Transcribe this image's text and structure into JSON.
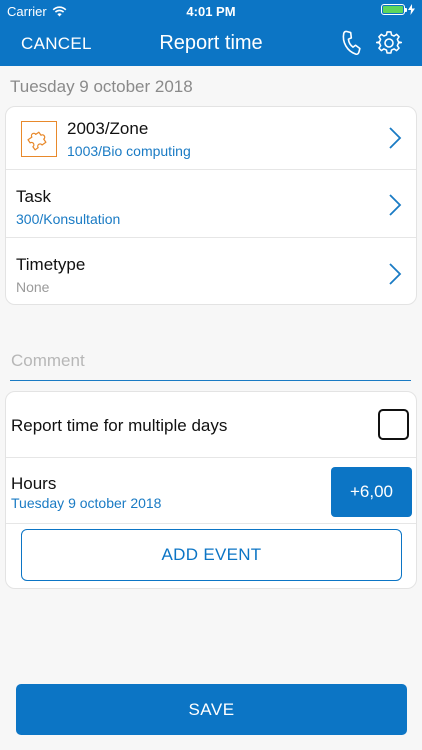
{
  "status_bar": {
    "carrier": "Carrier",
    "time": "4:01 PM"
  },
  "nav": {
    "cancel_label": "CANCEL",
    "title": "Report time",
    "phone_icon": "phone-icon",
    "settings_icon": "gear-icon"
  },
  "date_heading": "Tuesday 9 october 2018",
  "project_row": {
    "icon": "puzzle-icon",
    "title": "2003/Zone",
    "subtitle": "1003/Bio computing"
  },
  "task_row": {
    "title": "Task",
    "subtitle": "300/Konsultation"
  },
  "timetype_row": {
    "title": "Timetype",
    "subtitle": "None"
  },
  "comment": {
    "placeholder": "Comment",
    "value": ""
  },
  "multiple_days": {
    "label": "Report time for multiple days",
    "checked": false
  },
  "hours": {
    "label": "Hours",
    "date": "Tuesday 9 october 2018",
    "value": "+6,00"
  },
  "add_event_label": "ADD EVENT",
  "save_label": "SAVE",
  "colors": {
    "primary": "#0c75c5",
    "link": "#1a7bc4",
    "accent_icon": "#e8892b",
    "muted": "#8a8a8a"
  }
}
